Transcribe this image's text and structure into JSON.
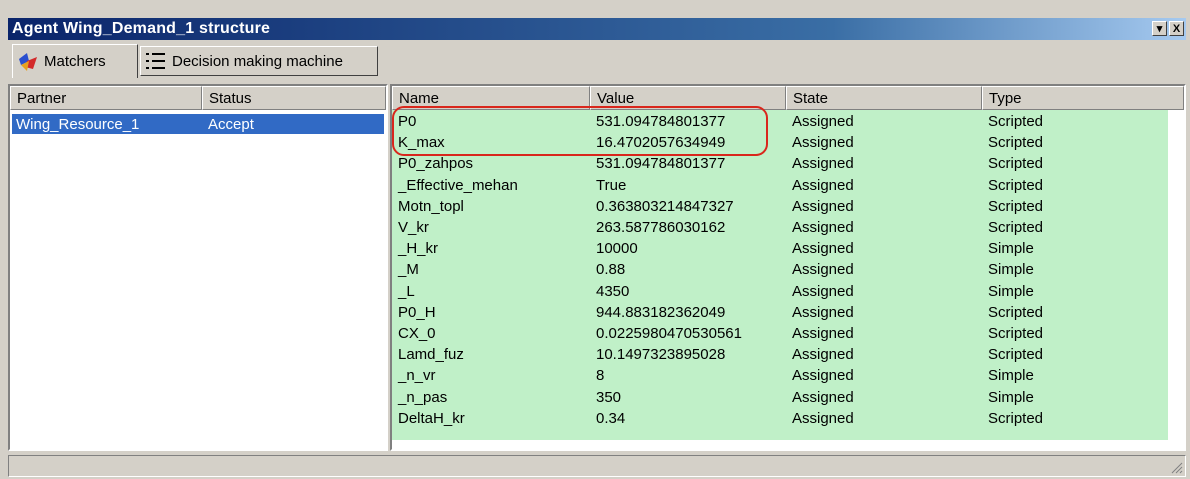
{
  "window": {
    "title": "Agent Wing_Demand_1 structure",
    "pin_glyph": "▾",
    "close_glyph": "X"
  },
  "tabs": [
    {
      "label": "Matchers",
      "icon": "matchers-icon",
      "active": true
    },
    {
      "label": "Decision making machine",
      "icon": "list-icon",
      "active": false
    }
  ],
  "matchers": {
    "columns": [
      "Partner",
      "Status"
    ],
    "rows": [
      {
        "partner": "Wing_Resource_1",
        "status": "Accept",
        "selected": true
      }
    ]
  },
  "variables": {
    "columns": [
      "Name",
      "Value",
      "State",
      "Type"
    ],
    "rows": [
      {
        "name": "P0",
        "value": "531.094784801377",
        "state": "Assigned",
        "type": "Scripted"
      },
      {
        "name": "K_max",
        "value": "16.4702057634949",
        "state": "Assigned",
        "type": "Scripted"
      },
      {
        "name": "P0_zahpos",
        "value": "531.094784801377",
        "state": "Assigned",
        "type": "Scripted"
      },
      {
        "name": "_Effective_mehan",
        "value": "True",
        "state": "Assigned",
        "type": "Scripted"
      },
      {
        "name": "Motn_topl",
        "value": "0.363803214847327",
        "state": "Assigned",
        "type": "Scripted"
      },
      {
        "name": "V_kr",
        "value": "263.587786030162",
        "state": "Assigned",
        "type": "Scripted"
      },
      {
        "name": "_H_kr",
        "value": "10000",
        "state": "Assigned",
        "type": "Simple"
      },
      {
        "name": "_M",
        "value": "0.88",
        "state": "Assigned",
        "type": "Simple"
      },
      {
        "name": "_L",
        "value": "4350",
        "state": "Assigned",
        "type": "Simple"
      },
      {
        "name": "P0_H",
        "value": "944.883182362049",
        "state": "Assigned",
        "type": "Scripted"
      },
      {
        "name": "CX_0",
        "value": "0.0225980470530561",
        "state": "Assigned",
        "type": "Scripted"
      },
      {
        "name": "Lamd_fuz",
        "value": "10.1497323895028",
        "state": "Assigned",
        "type": "Scripted"
      },
      {
        "name": "_n_vr",
        "value": "8",
        "state": "Assigned",
        "type": "Simple"
      },
      {
        "name": "_n_pas",
        "value": "350",
        "state": "Assigned",
        "type": "Simple"
      },
      {
        "name": "DeltaH_kr",
        "value": "0.34",
        "state": "Assigned",
        "type": "Scripted"
      }
    ],
    "row_background": "#c0f0c8"
  },
  "colors": {
    "title_bar": "#0a246a",
    "selection": "#316ac5",
    "highlight_outline": "#d9261c"
  }
}
